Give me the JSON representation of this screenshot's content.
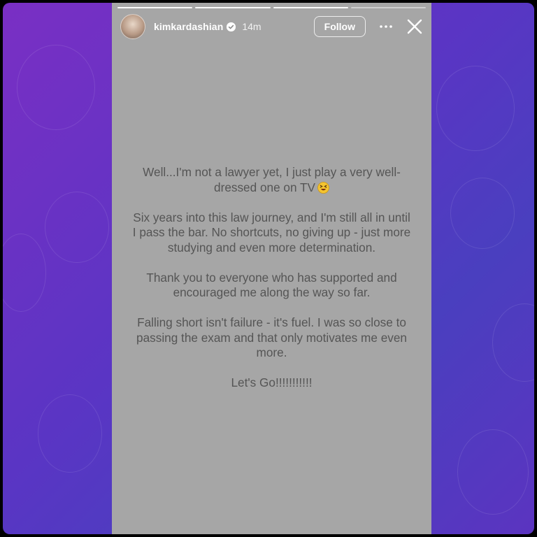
{
  "story": {
    "username": "kimkardashian",
    "timestamp": "14m",
    "follow_label": "Follow",
    "progress": {
      "segments": 4,
      "current": 3
    },
    "paragraphs": [
      "Well...I'm not a lawyer yet, I just play a very well-dressed one on TV",
      "Six years into this law journey, and I'm still all in until I pass the bar. No shortcuts, no giving up - just more studying and even more determination.",
      "Thank you to everyone who has supported and encouraged me along the way so far.",
      "Falling short isn't failure - it's fuel. I was so close to passing the exam and that only motivates me even more.",
      "Let's Go!!!!!!!!!!!"
    ],
    "emoji": "grinning-squinting-face-emoji"
  },
  "colors": {
    "background_purple": "#6a33c4",
    "story_gray": "#a6a6a6",
    "text_gray": "#555555"
  }
}
